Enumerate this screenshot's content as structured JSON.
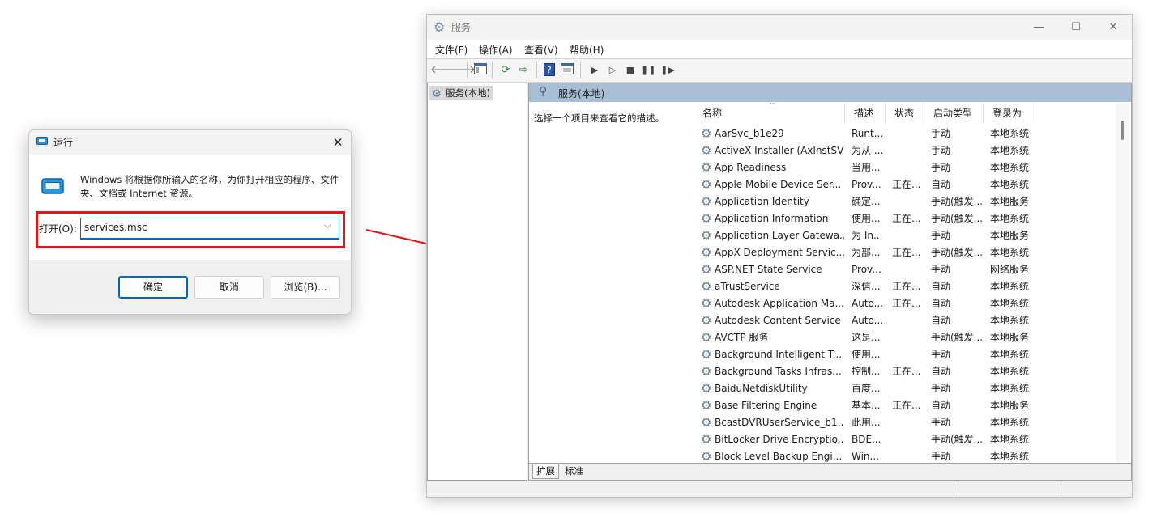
{
  "run_dialog": {
    "title": "运行",
    "prompt": "Windows 将根据你所输入的名称，为你打开相应的程序、文件夹、文档或 Internet 资源。",
    "open_label": "打开(O):",
    "command_value": "services.msc",
    "ok_label": "确定",
    "cancel_label": "取消",
    "browse_label": "浏览(B)...",
    "close_glyph": "✕",
    "highlight_color": "#e8141a"
  },
  "services_window": {
    "title": "服务",
    "controls": {
      "minimize": "—",
      "maximize": "☐",
      "close": "✕"
    },
    "menu": [
      "文件(F)",
      "操作(A)",
      "查看(V)",
      "帮助(H)"
    ],
    "toolbar_icons": [
      "back-icon",
      "forward-icon",
      "console-tree-icon",
      "refresh-icon",
      "export-icon",
      "help-icon",
      "properties-icon",
      "start-icon",
      "start-paused-icon",
      "stop-icon",
      "pause-icon",
      "restart-icon"
    ],
    "tree_item": "服务(本地)",
    "pane_title": "服务(本地)",
    "description_prompt": "选择一个项目来查看它的描述。",
    "columns": [
      "名称",
      "描述",
      "状态",
      "启动类型",
      "登录为"
    ],
    "services": [
      [
        "AarSvc_b1e29",
        "Runt...",
        "",
        "手动",
        "本地系统"
      ],
      [
        "ActiveX Installer (AxInstSV)",
        "为从 ...",
        "",
        "手动",
        "本地系统"
      ],
      [
        "App Readiness",
        "当用...",
        "",
        "手动",
        "本地系统"
      ],
      [
        "Apple Mobile Device Ser...",
        "Prov...",
        "正在...",
        "自动",
        "本地系统"
      ],
      [
        "Application Identity",
        "确定...",
        "",
        "手动(触发...",
        "本地服务"
      ],
      [
        "Application Information",
        "使用...",
        "正在...",
        "手动(触发...",
        "本地系统"
      ],
      [
        "Application Layer Gatewa...",
        "为 In...",
        "",
        "手动",
        "本地服务"
      ],
      [
        "AppX Deployment Servic...",
        "为部...",
        "正在...",
        "手动(触发...",
        "本地系统"
      ],
      [
        "ASP.NET State Service",
        "Prov...",
        "",
        "手动",
        "网络服务"
      ],
      [
        "aTrustService",
        "深信...",
        "正在...",
        "自动",
        "本地系统"
      ],
      [
        "Autodesk Application Ma...",
        "Auto...",
        "正在...",
        "自动",
        "本地系统"
      ],
      [
        "Autodesk Content Service",
        "Auto...",
        "",
        "自动",
        "本地系统"
      ],
      [
        "AVCTP 服务",
        "这是...",
        "",
        "手动(触发...",
        "本地服务"
      ],
      [
        "Background Intelligent T...",
        "使用...",
        "",
        "手动",
        "本地系统"
      ],
      [
        "Background Tasks Infras...",
        "控制...",
        "正在...",
        "自动",
        "本地系统"
      ],
      [
        "BaiduNetdiskUtility",
        "百度...",
        "",
        "手动",
        "本地系统"
      ],
      [
        "Base Filtering Engine",
        "基本...",
        "正在...",
        "自动",
        "本地服务"
      ],
      [
        "BcastDVRUserService_b1...",
        "此用...",
        "",
        "手动",
        "本地系统"
      ],
      [
        "BitLocker Drive Encryptio...",
        "BDE...",
        "",
        "手动(触发...",
        "本地系统"
      ],
      [
        "Block Level Backup Engi...",
        "Win...",
        "",
        "手动",
        "本地系统"
      ]
    ],
    "tabs": [
      "扩展",
      "标准"
    ]
  }
}
